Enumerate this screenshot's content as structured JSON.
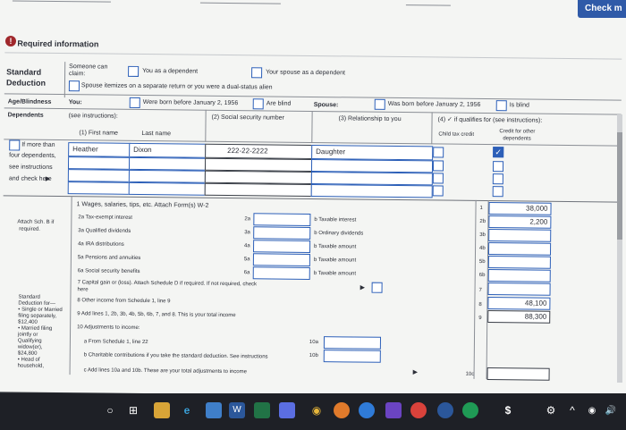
{
  "header": {
    "check_button": "Check m",
    "alert_icon": "!",
    "section_title": "Required information"
  },
  "standard_deduction": {
    "label_1": "Standard",
    "label_2": "Deduction",
    "someone_can_claim_1": "Someone can",
    "someone_can_claim_2": "claim:",
    "you_dependent": "You as a dependent",
    "spouse_dependent": "Your spouse as a dependent",
    "spouse_itemizes": "Spouse itemizes on a separate return or you were a dual-status alien"
  },
  "age_blindness": {
    "label": "Age/Blindness",
    "you": "You:",
    "you_born_before": "Were born before January 2, 1956",
    "you_blind": "Are blind",
    "spouse": "Spouse:",
    "spouse_born_before": "Was born before January 2, 1956",
    "spouse_blind": "Is blind"
  },
  "dependents": {
    "label": "Dependents",
    "see_instructions": "(see instructions):",
    "col1_first": "(1) First name",
    "col1_last": "Last name",
    "col2": "(2) Social security number",
    "col3": "(3) Relationship to you",
    "col4": "(4) ✓ if qualifies for (see instructions):",
    "col4_child": "Child tax credit",
    "col4_other_1": "Credit for other",
    "col4_other_2": "dependents",
    "more_than_1": "If more than",
    "more_than_2": "four dependents,",
    "more_than_3": "see instructions",
    "more_than_4": "and check here",
    "row1_first": "Heather",
    "row1_last": "Dixon",
    "row1_ssn": "222-22-2222",
    "row1_relationship": "Daughter",
    "checkmark": "✓"
  },
  "income": {
    "attach_1": "Attach Sch. B if",
    "attach_2": "required.",
    "line1": "1 Wages, salaries, tips, etc. Attach Form(s) W-2",
    "line1_num": "1",
    "line1_value": "38,000",
    "line2a": "2a Tax-exempt interest",
    "line2a_num": "2a",
    "line2b": "b Taxable interest",
    "line2b_num": "2b",
    "line2b_value": "2,200",
    "line3a": "3a Qualified dividends",
    "line3a_num": "3a",
    "line3b": "b Ordinary dividends",
    "line3b_num": "3b",
    "line4a": "4a IRA distributions",
    "line4a_num": "4a",
    "line4b": "b Taxable amount",
    "line4b_num": "4b",
    "line5a": "5a Pensions and annuities",
    "line5a_num": "5a",
    "line5b": "b Taxable amount",
    "line5b_num": "5b",
    "line6a": "6a Social security benefits",
    "line6a_num": "6a",
    "line6b": "b Taxable amount",
    "line6b_num": "6b",
    "line7_1": "7 Capital gain or (loss). Attach Schedule D if required. If not required, check",
    "line7_2": "here",
    "line7_num": "7",
    "line8": "8 Other income from Schedule 1, line 9",
    "line8_num": "8",
    "line8_value": "48,100",
    "line9": "9 Add lines 1, 2b, 3b, 4b, 5b, 6b, 7, and 8. This is your total income",
    "line9_num": "9",
    "line9_value": "88,300",
    "line10": "10 Adjustments to income:",
    "line10a": "a From Schedule 1, line 22",
    "line10a_num": "10a",
    "line10b": "b Charitable contributions if you take the standard deduction. See instructions",
    "line10b_num": "10b",
    "line10c": "c Add lines 10a and 10b. These are your total adjustments to income",
    "line10c_num": "10c"
  },
  "sidebar_std": {
    "l1": "Standard",
    "l2": "Deduction for—",
    "l3": "• Single or Married",
    "l4": "filing separately,",
    "l5": "$12,400",
    "l6": "• Married filing",
    "l7": "jointly or",
    "l8": "Qualifying",
    "l9": "widow(er),",
    "l10": "$24,800",
    "l11": "• Head of",
    "l12": "household,"
  },
  "taskbar": {
    "start": "○",
    "taskview": "⊞",
    "edge": "e",
    "word": "W",
    "chrome": "◉",
    "dollar": "$",
    "gear": "⚙",
    "chevron": "^",
    "volume": "🔊"
  }
}
